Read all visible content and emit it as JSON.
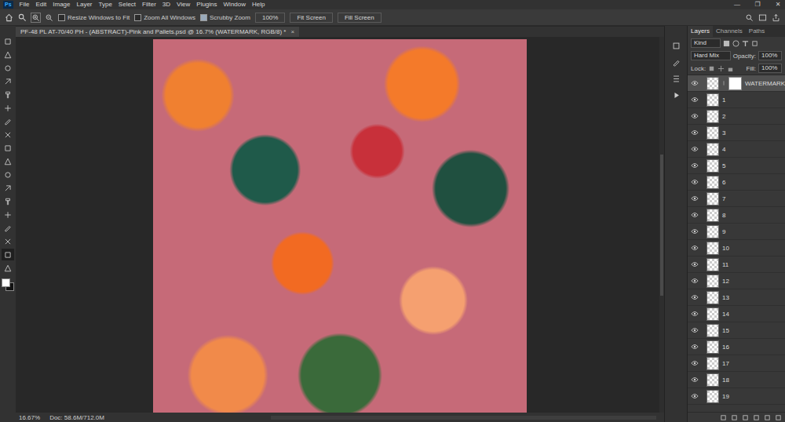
{
  "app": {
    "logo": "Ps",
    "menu": [
      "File",
      "Edit",
      "Image",
      "Layer",
      "Type",
      "Select",
      "Filter",
      "3D",
      "View",
      "Plugins",
      "Window",
      "Help"
    ],
    "window_controls": [
      "—",
      "❐",
      "✕"
    ]
  },
  "options": {
    "checks": [
      {
        "label": "Resize Windows to Fit",
        "checked": false
      },
      {
        "label": "Zoom All Windows",
        "checked": false
      },
      {
        "label": "Scrubby Zoom",
        "checked": true
      }
    ],
    "buttons": [
      "100%",
      "Fit Screen",
      "Fill Screen"
    ]
  },
  "tools": [
    {
      "selected": false
    },
    {
      "selected": false
    },
    {
      "selected": false
    },
    {
      "selected": false
    },
    {
      "selected": false
    },
    {
      "selected": false
    },
    {
      "selected": false
    },
    {
      "selected": false
    },
    {
      "selected": false
    },
    {
      "selected": false
    },
    {
      "selected": false
    },
    {
      "selected": false
    },
    {
      "selected": false
    },
    {
      "selected": false
    },
    {
      "selected": false
    },
    {
      "selected": false
    },
    {
      "selected": true
    },
    {
      "selected": false
    }
  ],
  "colors": {
    "foreground": "#ffffff",
    "background": "#111111"
  },
  "document": {
    "tab_title": "PF-48 PL AT-70/40 PH - (ABSTRACT)-Pink and Pallets.psd @ 16.7% (WATERMARK, RGB/8) *",
    "close": "×",
    "zoom": "16.67%",
    "info": "Doc: 58.6M/712.0M"
  },
  "layers_panel": {
    "tabs": [
      {
        "label": "Layers",
        "selected": true
      },
      {
        "label": "Channels",
        "selected": false
      },
      {
        "label": "Paths",
        "selected": false
      }
    ],
    "filter": "Kind",
    "blend_mode": "Hard Mix",
    "opacity_label": "Opacity:",
    "opacity": "100%",
    "lock_label": "Lock:",
    "fill_label": "Fill:",
    "fill": "100%",
    "layers": [
      {
        "name": "WATERMARK",
        "visible": true,
        "selected": true,
        "mask": true
      },
      {
        "name": "1",
        "visible": true,
        "selected": false,
        "mask": false
      },
      {
        "name": "2",
        "visible": true,
        "selected": false,
        "mask": false
      },
      {
        "name": "3",
        "visible": true,
        "selected": false,
        "mask": false
      },
      {
        "name": "4",
        "visible": true,
        "selected": false,
        "mask": false
      },
      {
        "name": "5",
        "visible": true,
        "selected": false,
        "mask": false
      },
      {
        "name": "6",
        "visible": true,
        "selected": false,
        "mask": false
      },
      {
        "name": "7",
        "visible": true,
        "selected": false,
        "mask": false
      },
      {
        "name": "8",
        "visible": true,
        "selected": false,
        "mask": false
      },
      {
        "name": "9",
        "visible": true,
        "selected": false,
        "mask": false
      },
      {
        "name": "10",
        "visible": true,
        "selected": false,
        "mask": false
      },
      {
        "name": "11",
        "visible": true,
        "selected": false,
        "mask": false
      },
      {
        "name": "12",
        "visible": true,
        "selected": false,
        "mask": false
      },
      {
        "name": "13",
        "visible": true,
        "selected": false,
        "mask": false
      },
      {
        "name": "14",
        "visible": true,
        "selected": false,
        "mask": false
      },
      {
        "name": "15",
        "visible": true,
        "selected": false,
        "mask": false
      },
      {
        "name": "16",
        "visible": true,
        "selected": false,
        "mask": false
      },
      {
        "name": "17",
        "visible": true,
        "selected": false,
        "mask": false
      },
      {
        "name": "18",
        "visible": true,
        "selected": false,
        "mask": false
      },
      {
        "name": "19",
        "visible": true,
        "selected": false,
        "mask": false
      }
    ]
  }
}
